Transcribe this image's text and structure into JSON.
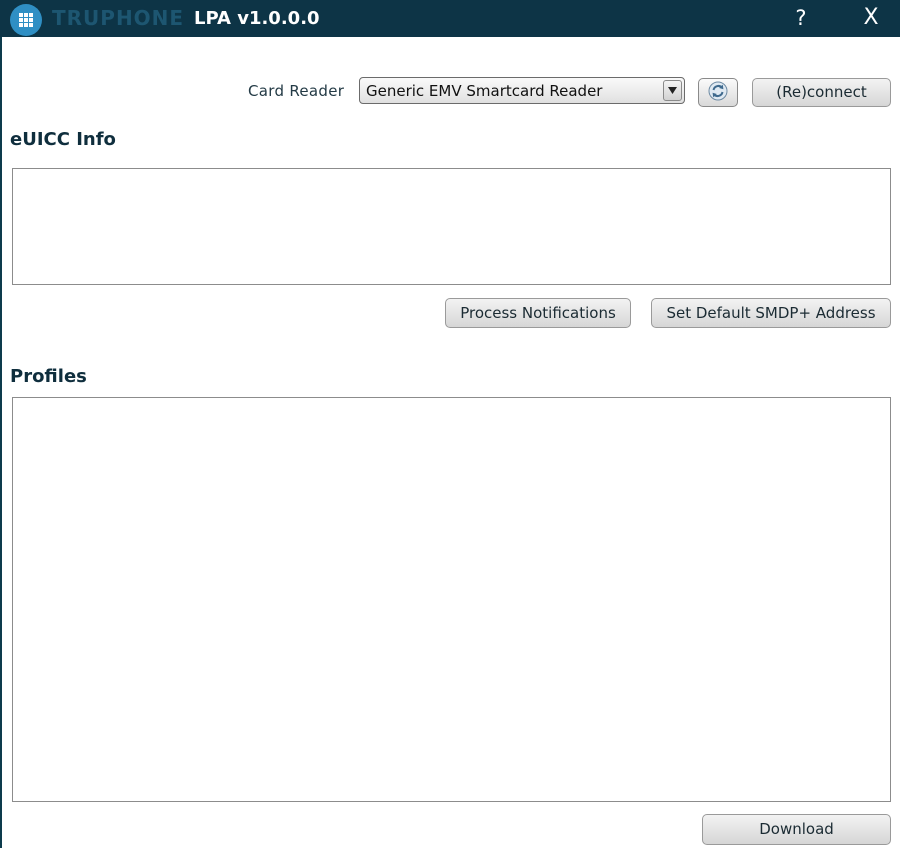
{
  "titlebar": {
    "brand": "TRUPHONE",
    "app_title": "LPA v1.0.0.0",
    "help_label": "?",
    "close_label": "X"
  },
  "card_reader": {
    "label": "Card Reader",
    "selected_reader": "Generic EMV Smartcard Reader",
    "refresh_icon": "refresh-icon",
    "reconnect_label": "(Re)connect"
  },
  "euicc": {
    "title": "eUICC Info",
    "process_notifications_label": "Process Notifications",
    "set_default_smdp_label": "Set Default SMDP+ Address"
  },
  "profiles": {
    "title": "Profiles",
    "download_label": "Download"
  },
  "colors": {
    "titlebar_bg": "#0d3446",
    "logo_accent": "#2f8fc4",
    "heading_text": "#0f2e3d"
  }
}
